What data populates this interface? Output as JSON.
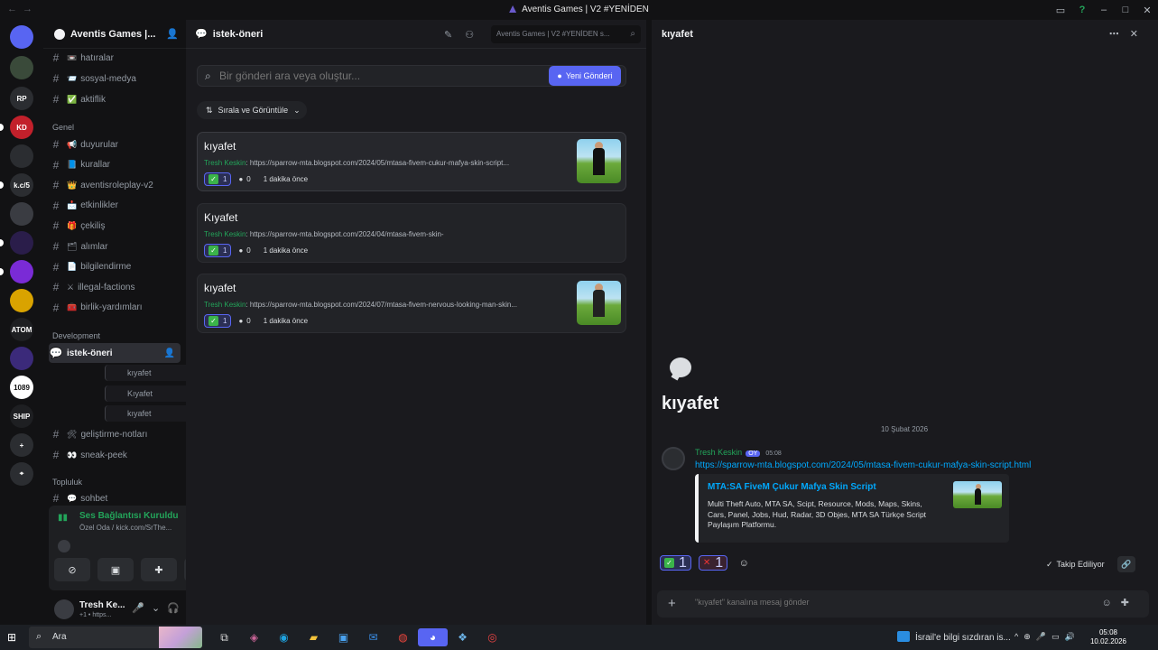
{
  "window": {
    "title": "Aventis Games | V2 #YENİDEN"
  },
  "server": {
    "name": "Aventis Games |..."
  },
  "servers": [
    {
      "label": "",
      "color": "#5865f2",
      "icon": "discord-icon"
    },
    {
      "label": "",
      "color": "#3a4a3a",
      "icon": "server-icon"
    },
    {
      "label": "RP",
      "color": "#2b2d31",
      "icon": "server-icon"
    },
    {
      "label": "KD",
      "color": "#c2202b",
      "icon": "server-icon"
    },
    {
      "label": "",
      "color": "#2b2d31",
      "icon": "server-icon"
    },
    {
      "label": "k.c/5",
      "color": "#2b2d31",
      "icon": "server-icon"
    },
    {
      "label": "",
      "color": "#3a3c42",
      "icon": "server-icon"
    },
    {
      "label": "",
      "color": "#2a1d4a",
      "icon": "server-icon"
    },
    {
      "label": "",
      "color": "#7a2bd6",
      "icon": "server-icon"
    },
    {
      "label": "",
      "color": "#d9a300",
      "icon": "server-icon"
    },
    {
      "label": "ATOM",
      "color": "#1e1f22",
      "icon": "server-icon"
    },
    {
      "label": "",
      "color": "#3b2a7a",
      "icon": "server-icon"
    },
    {
      "label": "1089",
      "color": "#ffffff",
      "icon": "server-icon"
    },
    {
      "label": "SHIP",
      "color": "#1e1f22",
      "icon": "server-icon"
    },
    {
      "label": "+",
      "color": "#2b2d31",
      "icon": "add-server-icon"
    },
    {
      "label": "⌖",
      "color": "#2b2d31",
      "icon": "discover-icon"
    }
  ],
  "channels": [
    {
      "name": "hatıralar",
      "emoji": "📼"
    },
    {
      "name": "sosyal-medya",
      "emoji": "📨"
    },
    {
      "name": "aktiflik",
      "emoji": "✅"
    }
  ],
  "cat_genel": "Genel",
  "channels_genel": [
    {
      "name": "duyurular",
      "emoji": "📢"
    },
    {
      "name": "kurallar",
      "emoji": "📘"
    },
    {
      "name": "aventisroleplay-v2",
      "emoji": "👑"
    },
    {
      "name": "etkinlikler",
      "emoji": "📩"
    },
    {
      "name": "çekiliş",
      "emoji": "🎁"
    },
    {
      "name": "alımlar",
      "emoji": "🗂"
    },
    {
      "name": "bilgilendirme",
      "emoji": "📄"
    },
    {
      "name": "illegal-factions",
      "emoji": "⚔"
    },
    {
      "name": "birlik-yardımları",
      "emoji": "🧰"
    }
  ],
  "cat_dev": "Development",
  "active_channel": "istek-öneri",
  "threads": [
    "kıyafet",
    "Kıyafet",
    "kıyafet"
  ],
  "channels_dev": [
    {
      "name": "geliştirme-notları",
      "emoji": "🛠"
    },
    {
      "name": "sneak-peek",
      "emoji": "👀"
    }
  ],
  "cat_topluluk": "Topluluk",
  "channels_topluluk": [
    {
      "name": "sohbet",
      "emoji": "💬"
    }
  ],
  "voice": {
    "status": "Ses Bağlantısı Kuruldu",
    "sub": "Özel Oda / kick.com/SrThe..."
  },
  "user": {
    "name": "Tresh Ke...",
    "status": "+1 • https..."
  },
  "forum": {
    "channel": "istek-öneri",
    "search_placeholder": "Aventis Games | V2 #YENİDEN s...",
    "post_placeholder": "Bir gönderi ara veya oluştur...",
    "new_post": "Yeni Gönderi",
    "sort": "Sırala ve Görüntüle",
    "posts": [
      {
        "title": "kıyafet",
        "author": "Tresh Keskin",
        "preview": ": https://sparrow-mta.blogspot.com/2024/05/mtasa-fivem-cukur-mafya-skin-script...",
        "reactions": "1",
        "comments": "0",
        "time": "1 dakika önce"
      },
      {
        "title": "Kıyafet",
        "author": "Tresh Keskin",
        "preview": ": https://sparrow-mta.blogspot.com/2024/04/mtasa-fivem-skin-",
        "reactions": "1",
        "comments": "0",
        "time": "1 dakika önce"
      },
      {
        "title": "kıyafet",
        "author": "Tresh Keskin",
        "preview": ": https://sparrow-mta.blogspot.com/2024/07/mtasa-fivem-nervous-looking-man-skin...",
        "reactions": "1",
        "comments": "0",
        "time": "1 dakika önce"
      }
    ]
  },
  "thread": {
    "title": "kıyafet",
    "date": "10 Şubat 2026",
    "author": "Tresh Keskin",
    "badge": "OY",
    "time": "05:08",
    "link": "https://sparrow-mta.blogspot.com/2024/05/mtasa-fivem-cukur-mafya-skin-script.html",
    "embed_title": "MTA:SA FiveM Çukur Mafya Skin Script",
    "embed_desc": "Multi Theft Auto, MTA SA, Scipt, Resource, Mods, Maps, Skins, Cars, Panel, Jobs, Hud, Radar, 3D Objes, MTA SA Türkçe Script Paylaşım Platformu.",
    "react_check": "1",
    "react_x": "1",
    "follow": "Takip Ediliyor",
    "composer_placeholder": "\"kıyafet\" kanalına mesaj gönder"
  },
  "taskbar": {
    "search": "Ara",
    "news": "İsrail'e bilgi sızdıran is...",
    "time": "05:08",
    "date": "10.02.2026"
  },
  "colors": {
    "accent": "#5865f2",
    "online": "#23a55a",
    "link": "#00a8fc"
  }
}
